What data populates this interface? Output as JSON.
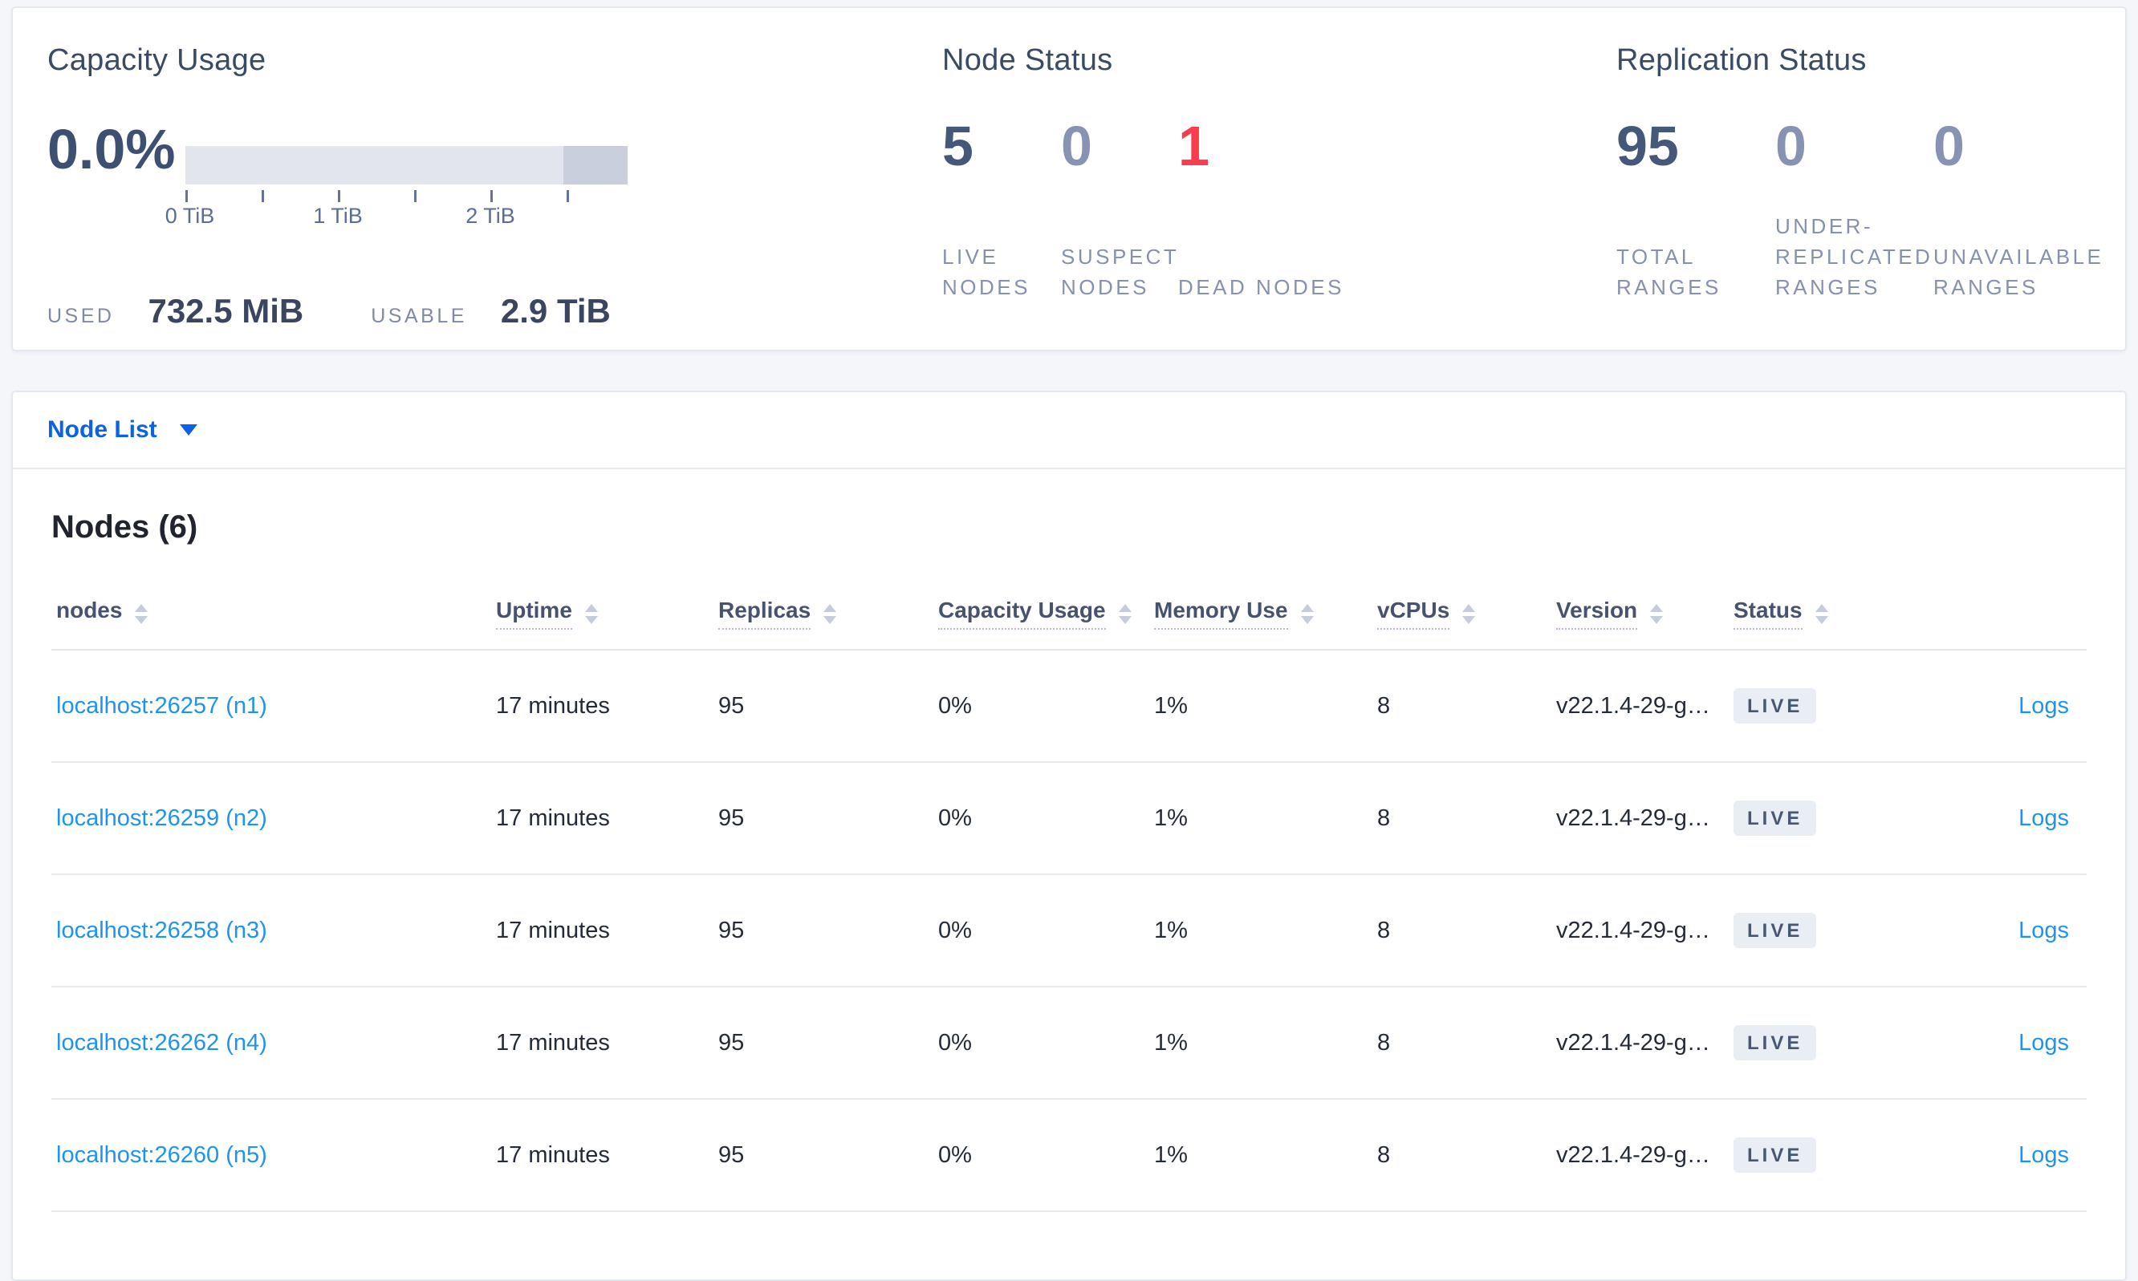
{
  "colors": {
    "page_bg": "#f4f6fa",
    "accent_blue": "#0c61e4",
    "link_blue": "#1e93f0",
    "stat_dark": "#46587a",
    "stat_muted": "#8793b3",
    "dead_red": "#fb3b4e",
    "badge_bg": "#e9edf4",
    "bar_light": "#e2e5ec",
    "bar_dark": "#cacfdd"
  },
  "summary": {
    "capacity": {
      "title": "Capacity Usage",
      "percent": "0.0%",
      "used_label": "USED",
      "used_value": "732.5 MiB",
      "usable_label": "USABLE",
      "usable_value": "2.9 TiB",
      "chart_data": {
        "type": "bar",
        "title": "Capacity Usage gauge",
        "used_fraction": 0.0,
        "light_segment_fraction": 0.855,
        "dark_segment_fraction": 0.145,
        "axis_max": "2.9 TiB",
        "tick_positions_tib": [
          0,
          0.5,
          1,
          1.5,
          2,
          2.5
        ],
        "tick_labels": [
          "0 TiB",
          "1 TiB",
          "2 TiB"
        ]
      }
    },
    "node_status": {
      "title": "Node Status",
      "stats": [
        {
          "value": "5",
          "label": "LIVE NODES"
        },
        {
          "value": "0",
          "label": "SUSPECT NODES"
        },
        {
          "value": "1",
          "label": "DEAD NODES"
        }
      ]
    },
    "replication": {
      "title": "Replication Status",
      "stats": [
        {
          "value": "95",
          "label": "TOTAL RANGES"
        },
        {
          "value": "0",
          "label": "UNDER-REPLICATED RANGES"
        },
        {
          "value": "0",
          "label": "UNAVAILABLE RANGES"
        }
      ]
    }
  },
  "node_list": {
    "label": "Node List"
  },
  "nodes_section": {
    "heading": "Nodes (6)",
    "columns": [
      {
        "label": "nodes"
      },
      {
        "label": "Uptime"
      },
      {
        "label": "Replicas"
      },
      {
        "label": "Capacity Usage"
      },
      {
        "label": "Memory Use"
      },
      {
        "label": "vCPUs"
      },
      {
        "label": "Version"
      },
      {
        "label": "Status"
      }
    ],
    "rows": [
      {
        "node": "localhost:26257 (n1)",
        "uptime": "17 minutes",
        "replicas": "95",
        "capacity": "0%",
        "memory": "1%",
        "vcpus": "8",
        "version": "v22.1.4-29-g…",
        "status": "LIVE",
        "logs": "Logs"
      },
      {
        "node": "localhost:26259 (n2)",
        "uptime": "17 minutes",
        "replicas": "95",
        "capacity": "0%",
        "memory": "1%",
        "vcpus": "8",
        "version": "v22.1.4-29-g…",
        "status": "LIVE",
        "logs": "Logs"
      },
      {
        "node": "localhost:26258 (n3)",
        "uptime": "17 minutes",
        "replicas": "95",
        "capacity": "0%",
        "memory": "1%",
        "vcpus": "8",
        "version": "v22.1.4-29-g…",
        "status": "LIVE",
        "logs": "Logs"
      },
      {
        "node": "localhost:26262 (n4)",
        "uptime": "17 minutes",
        "replicas": "95",
        "capacity": "0%",
        "memory": "1%",
        "vcpus": "8",
        "version": "v22.1.4-29-g…",
        "status": "LIVE",
        "logs": "Logs"
      },
      {
        "node": "localhost:26260 (n5)",
        "uptime": "17 minutes",
        "replicas": "95",
        "capacity": "0%",
        "memory": "1%",
        "vcpus": "8",
        "version": "v22.1.4-29-g…",
        "status": "LIVE",
        "logs": "Logs"
      }
    ]
  }
}
